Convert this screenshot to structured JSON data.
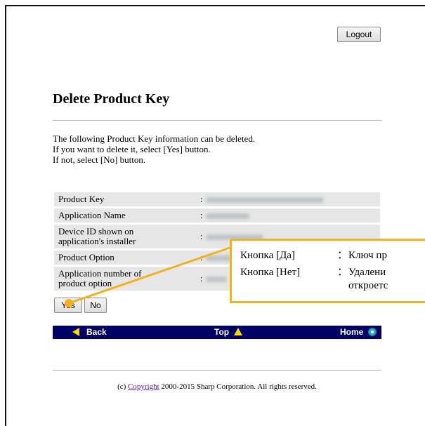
{
  "header": {
    "logout_label": "Logout"
  },
  "page": {
    "title": "Delete Product Key",
    "intro": [
      "The following Product Key information can be deleted.",
      "If you want to delete it, select [Yes] button.",
      "If not, select [No] button."
    ]
  },
  "info_rows": [
    {
      "label": "Product Key",
      "value": ":"
    },
    {
      "label": "Application Name",
      "value": ":"
    },
    {
      "label_lines": [
        "Device ID shown on",
        "application's installer"
      ],
      "value": ":"
    },
    {
      "label": "Product Option",
      "value": ":"
    },
    {
      "label_lines": [
        "Application number of",
        "product option"
      ],
      "value": ":"
    }
  ],
  "actions": {
    "yes_label": "Yes",
    "no_label": "No"
  },
  "navbar": {
    "back_label": "Back",
    "top_label": "Top",
    "home_label": "Home",
    "background": "#000066",
    "arrow_color": "#ffd700"
  },
  "footer": {
    "prefix": "(c) ",
    "link_text": "Copyright",
    "suffix": " 2000-2015 Sharp Corporation. All rights reserved."
  },
  "callout": {
    "border_color": "#f2b21b",
    "rows": [
      {
        "key": "Кнопка [Да]",
        "sep": "：",
        "text": "Ключ пр"
      },
      {
        "key": "Кнопка [Нет]",
        "sep": "：",
        "text": "Удалени",
        "text2": "откроетс"
      }
    ]
  }
}
